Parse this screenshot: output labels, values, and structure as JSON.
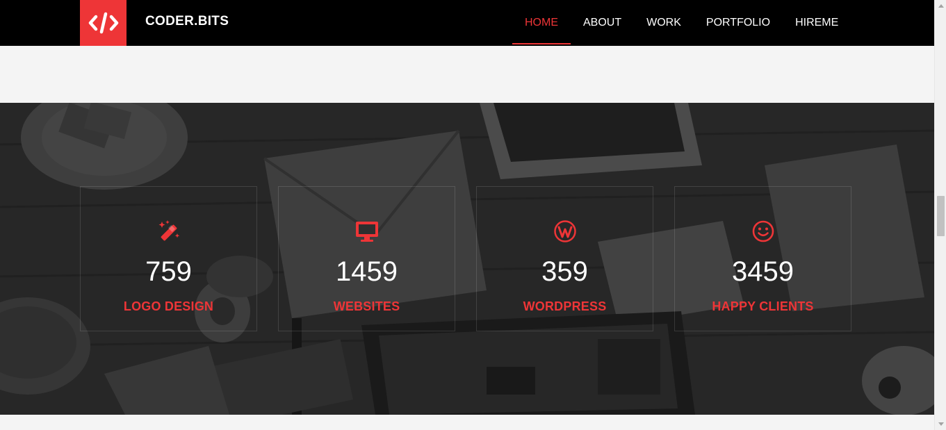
{
  "brand": {
    "name": "CODER.BITS",
    "logo_glyph": "</>",
    "accent_color": "#ee3537"
  },
  "nav": {
    "items": [
      {
        "label": "HOME",
        "active": true
      },
      {
        "label": "ABOUT",
        "active": false
      },
      {
        "label": "WORK",
        "active": false
      },
      {
        "label": "PORTFOLIO",
        "active": false
      },
      {
        "label": "HIREME",
        "active": false
      }
    ]
  },
  "stats": [
    {
      "icon": "magic-wand-icon",
      "value": "759",
      "label": "LOGO DESIGN"
    },
    {
      "icon": "monitor-icon",
      "value": "1459",
      "label": "WEBSITES"
    },
    {
      "icon": "wordpress-icon",
      "value": "359",
      "label": "WORDPRESS"
    },
    {
      "icon": "smile-icon",
      "value": "3459",
      "label": "HAPPY CLIENTS"
    }
  ]
}
